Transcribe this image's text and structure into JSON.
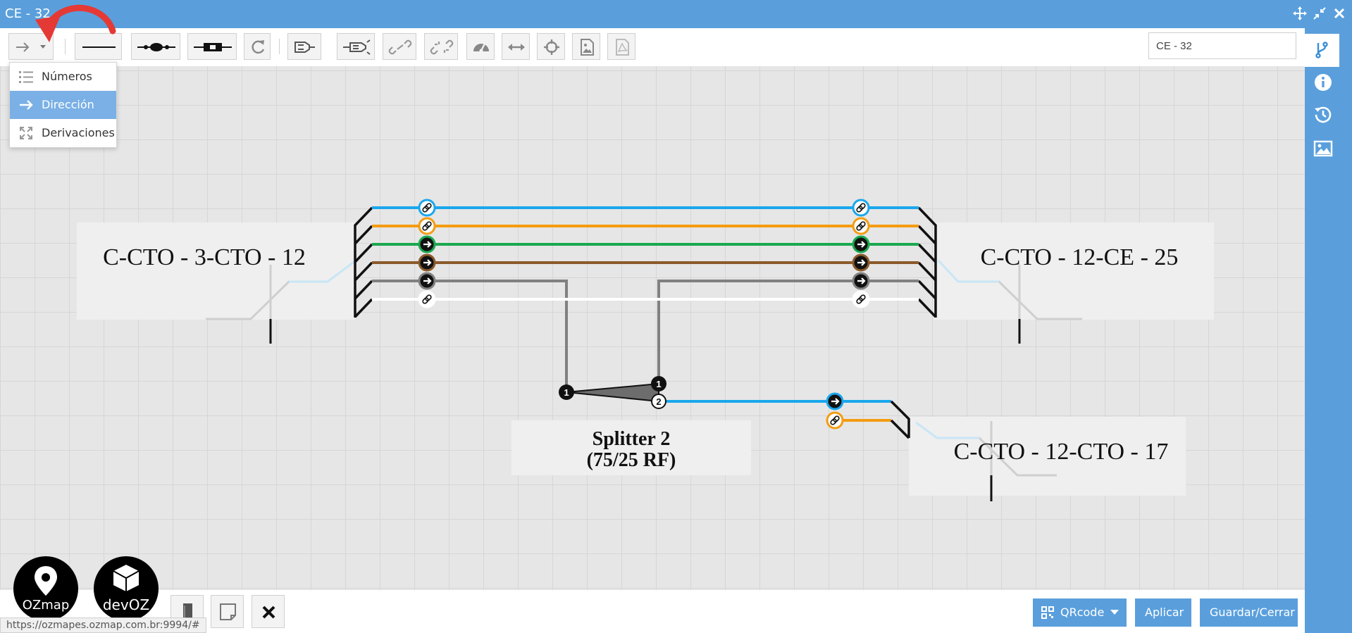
{
  "window": {
    "title": "CE - 32",
    "controls": [
      "move-icon",
      "collapse-icon",
      "close-icon"
    ]
  },
  "toolbar": {
    "buttons": [
      {
        "name": "arrow-dropdown-button",
        "icon": "arrow-right-icon"
      },
      {
        "name": "line-tool-button",
        "icon": "line-icon"
      },
      {
        "name": "fusion-tool-button",
        "icon": "fusion-icon"
      },
      {
        "name": "connector-tool-button",
        "icon": "connector-icon"
      },
      {
        "name": "refresh-button",
        "icon": "refresh-icon"
      },
      {
        "name": "light-source-button",
        "icon": "light-source-icon"
      },
      {
        "name": "power-meter-button",
        "icon": "power-meter-icon"
      },
      {
        "name": "link-button",
        "icon": "link-icon"
      },
      {
        "name": "unlink-button",
        "icon": "unlink-icon"
      },
      {
        "name": "gauge-button",
        "icon": "gauge-icon"
      },
      {
        "name": "distance-button",
        "icon": "distance-icon"
      },
      {
        "name": "center-button",
        "icon": "crosshair-icon"
      },
      {
        "name": "export-image-button",
        "icon": "image-icon"
      },
      {
        "name": "export-pdf-button",
        "icon": "pdf-icon"
      }
    ],
    "name_input_value": "CE - 32"
  },
  "dropdown": {
    "items": [
      {
        "label": "Números",
        "icon": "list-icon",
        "active": false
      },
      {
        "label": "Dirección",
        "icon": "arrow-right-icon",
        "active": true
      },
      {
        "label": "Derivaciones",
        "icon": "expand-icon",
        "active": false
      }
    ]
  },
  "sidebar": {
    "items": [
      {
        "icon": "branch-icon",
        "active": true
      },
      {
        "icon": "info-icon",
        "active": false
      },
      {
        "icon": "history-icon",
        "active": false
      },
      {
        "icon": "image-icon",
        "active": false
      }
    ]
  },
  "diagram": {
    "cables": [
      {
        "label": "C-CTO - 3-CTO - 12"
      },
      {
        "label": "C-CTO - 12-CE - 25"
      },
      {
        "label": "C-CTO - 12-CTO - 17"
      }
    ],
    "splitter": {
      "line1": "Splitter 2",
      "line2": "(75/25 RF)",
      "ports": [
        "1",
        "1",
        "2"
      ]
    },
    "fiber_colors": [
      "#1aa7ec",
      "#f39c12",
      "#1aa84f",
      "#8b5a2b",
      "#808080",
      "#ffffff"
    ]
  },
  "bottom": {
    "logos": [
      {
        "text": "OZmap"
      },
      {
        "text": "devOZ"
      }
    ],
    "tools": [
      "book-icon",
      "note-icon",
      "delete-x-icon"
    ],
    "buttons": {
      "qrcode": "QRcode",
      "apply": "Aplicar",
      "save": "Guardar/Cerrar"
    },
    "status_url": "https://ozmapes.ozmap.com.br:9994/#"
  },
  "colors": {
    "accent": "#5a9fdc",
    "active_menu": "#7ab0e6",
    "annotation_arrow": "#e53935"
  }
}
